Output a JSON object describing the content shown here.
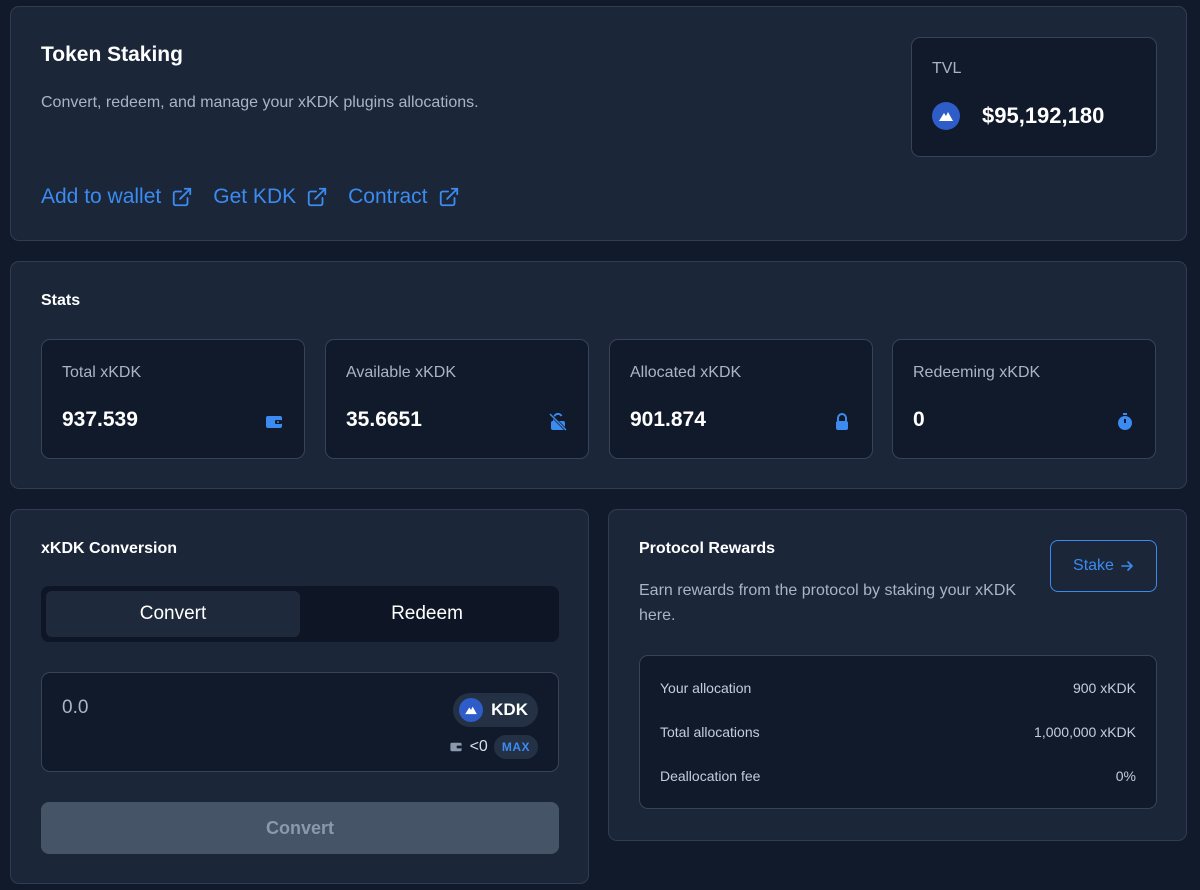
{
  "header": {
    "title": "Token Staking",
    "subtitle": "Convert, redeem, and manage your xKDK plugins allocations.",
    "links": [
      {
        "label": "Add to wallet",
        "icon": "external-link-icon"
      },
      {
        "label": "Get KDK",
        "icon": "external-link-icon"
      },
      {
        "label": "Contract",
        "icon": "external-link-icon"
      }
    ],
    "tvl": {
      "label": "TVL",
      "value": "$95,192,180",
      "icon": "kdk-token-icon"
    }
  },
  "stats": {
    "title": "Stats",
    "items": [
      {
        "label": "Total xKDK",
        "value": "937.539",
        "icon": "wallet-icon"
      },
      {
        "label": "Available xKDK",
        "value": "35.6651",
        "icon": "unlock-icon"
      },
      {
        "label": "Allocated xKDK",
        "value": "901.874",
        "icon": "lock-icon"
      },
      {
        "label": "Redeeming xKDK",
        "value": "0",
        "icon": "timer-icon"
      }
    ]
  },
  "conversion": {
    "title": "xKDK Conversion",
    "tabs": [
      {
        "label": "Convert",
        "active": true
      },
      {
        "label": "Redeem",
        "active": false
      }
    ],
    "amount_placeholder": "0.0",
    "token": "KDK",
    "balance": "<0",
    "max_label": "MAX",
    "submit_label": "Convert"
  },
  "rewards": {
    "title": "Protocol Rewards",
    "description": "Earn rewards from the protocol by staking your xKDK here.",
    "stake_label": "Stake",
    "rows": [
      {
        "label": "Your allocation",
        "value": "900 xKDK"
      },
      {
        "label": "Total allocations",
        "value": "1,000,000 xKDK"
      },
      {
        "label": "Deallocation fee",
        "value": "0%"
      }
    ]
  },
  "colors": {
    "background": "#111a2a",
    "card": "#1b2639",
    "accent": "#3b8bf0",
    "disabled_button": "#465467"
  }
}
